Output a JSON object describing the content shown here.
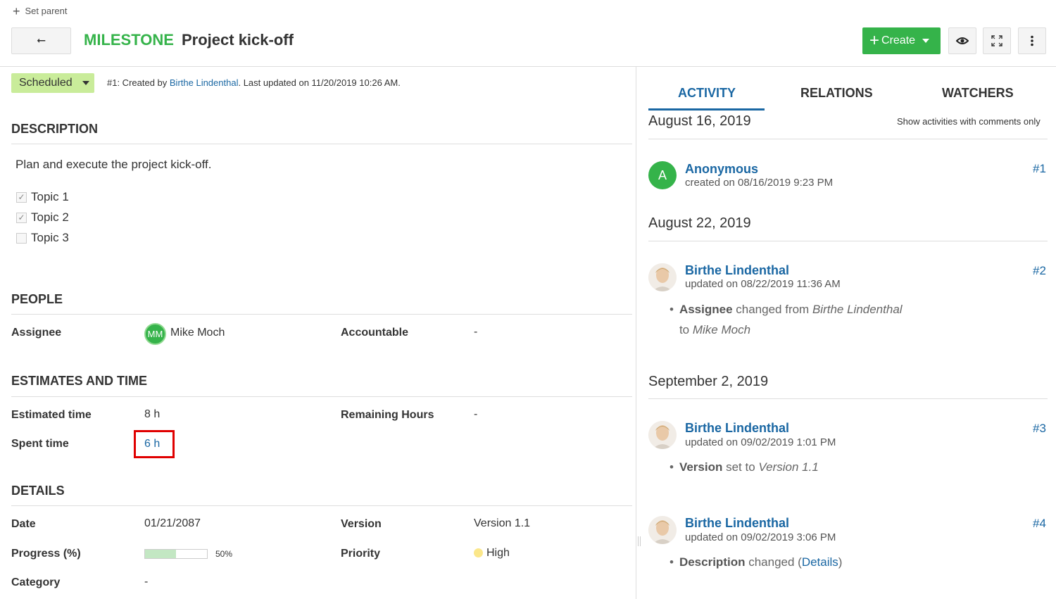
{
  "toolbar": {
    "set_parent": "Set parent",
    "back_arrow": "⭠",
    "type": "MILESTONE",
    "subject": "Project kick-off",
    "create_label": "Create"
  },
  "status": {
    "label": "Scheduled",
    "meta_prefix": "#1: Created by ",
    "author": "Birthe Lindenthal",
    "meta_suffix": ". Last updated on 11/20/2019 10:26 AM."
  },
  "description": {
    "title": "DESCRIPTION",
    "text": "Plan and execute the project kick-off.",
    "topics": [
      {
        "label": "Topic 1",
        "checked": true
      },
      {
        "label": "Topic 2",
        "checked": true
      },
      {
        "label": "Topic 3",
        "checked": false
      }
    ]
  },
  "people": {
    "title": "PEOPLE",
    "assignee_label": "Assignee",
    "assignee_initials": "MM",
    "assignee_name": "Mike Moch",
    "accountable_label": "Accountable",
    "accountable_value": "-"
  },
  "estimates": {
    "title": "ESTIMATES AND TIME",
    "estimated_label": "Estimated time",
    "estimated_value": "8 h",
    "remaining_label": "Remaining Hours",
    "remaining_value": "-",
    "spent_label": "Spent time",
    "spent_value": "6 h"
  },
  "details": {
    "title": "DETAILS",
    "date_label": "Date",
    "date_value": "01/21/2087",
    "version_label": "Version",
    "version_value": "Version 1.1",
    "progress_label": "Progress (%)",
    "progress_value": 50,
    "progress_text": "50%",
    "priority_label": "Priority",
    "priority_value": "High",
    "category_label": "Category",
    "category_value": "-"
  },
  "tabs": {
    "activity": "ACTIVITY",
    "relations": "RELATIONS",
    "watchers": "WATCHERS"
  },
  "activity": {
    "comments_only": "Show activities with comments only",
    "dates": [
      "August 16, 2019",
      "August 22, 2019",
      "September 2, 2019"
    ],
    "entries": [
      {
        "user": "Anonymous",
        "sub": "created on 08/16/2019 9:23 PM",
        "num": "#1",
        "initial": "A"
      },
      {
        "user": "Birthe Lindenthal",
        "sub": "updated on 08/22/2019 11:36 AM",
        "num": "#2",
        "b1_field": "Assignee",
        "b1_mid": " changed from ",
        "b1_from": "Birthe Lindenthal",
        "b1_to_word": "to ",
        "b1_to": "Mike Moch"
      },
      {
        "user": "Birthe Lindenthal",
        "sub": "updated on 09/02/2019 1:01 PM",
        "num": "#3",
        "b1_field": "Version",
        "b1_mid": " set to ",
        "b1_to": "Version 1.1"
      },
      {
        "user": "Birthe Lindenthal",
        "sub": "updated on 09/02/2019 3:06 PM",
        "num": "#4",
        "b1_field": "Description",
        "b1_mid": " changed (",
        "b1_link": "Details",
        "b1_end": ")"
      }
    ]
  }
}
